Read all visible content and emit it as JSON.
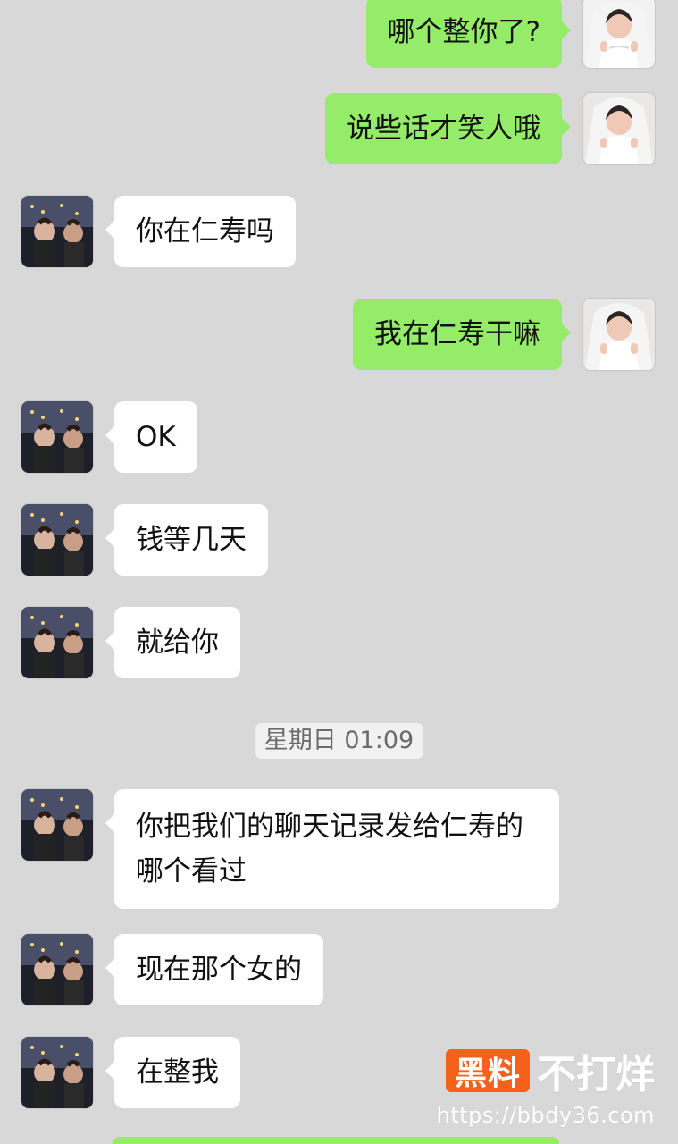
{
  "messages": [
    {
      "side": "right",
      "text": "哪个整你了?"
    },
    {
      "side": "right",
      "text": "说些话才笑人哦"
    },
    {
      "side": "left",
      "text": "你在仁寿吗"
    },
    {
      "side": "right",
      "text": "我在仁寿干嘛"
    },
    {
      "side": "left",
      "text": "OK"
    },
    {
      "side": "left",
      "text": "钱等几天"
    },
    {
      "side": "left",
      "text": "就给你"
    },
    {
      "side": "left",
      "text": "你把我们的聊天记录发给仁寿的哪个看过"
    },
    {
      "side": "left",
      "text": "现在那个女的"
    },
    {
      "side": "left",
      "text": "在整我"
    }
  ],
  "timestamp": "星期日 01:09",
  "watermark": {
    "badge": "黑料",
    "title": "不打烊",
    "url": "https://bbdy36.com"
  },
  "colors": {
    "background": "#d8d8d8",
    "incoming_bubble": "#ffffff",
    "outgoing_bubble": "#95ec69",
    "timestamp_bg": "rgba(255,255,255,0.65)",
    "watermark_accent": "#f4611a"
  }
}
